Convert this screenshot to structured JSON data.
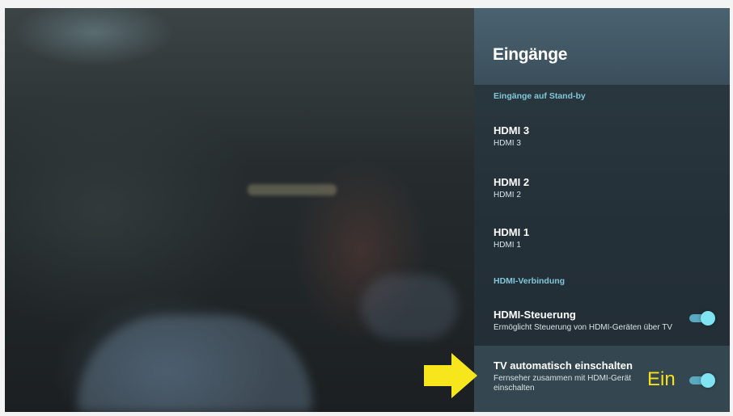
{
  "panel": {
    "title": "Eingänge",
    "sections": [
      {
        "label": "Eingänge auf Stand-by",
        "items": [
          {
            "title": "HDMI 3",
            "subtitle": "HDMI 3"
          },
          {
            "title": "HDMI 2",
            "subtitle": "HDMI 2"
          },
          {
            "title": "HDMI 1",
            "subtitle": "HDMI 1"
          }
        ]
      },
      {
        "label": "HDMI-Verbindung",
        "items": [
          {
            "title": "HDMI-Steuerung",
            "subtitle": "Ermöglicht Steuerung von HDMI-Geräten über TV",
            "toggle": "on"
          },
          {
            "title": "TV automatisch einschalten",
            "subtitle": "Fernseher zusammen mit HDMI-Gerät einschalten",
            "toggle": "on"
          }
        ]
      }
    ]
  },
  "annotation": {
    "label": "Ein",
    "color": "#f7e21a"
  },
  "colors": {
    "accent": "#7fc7d9",
    "toggle_on": "#7fe3f2"
  }
}
